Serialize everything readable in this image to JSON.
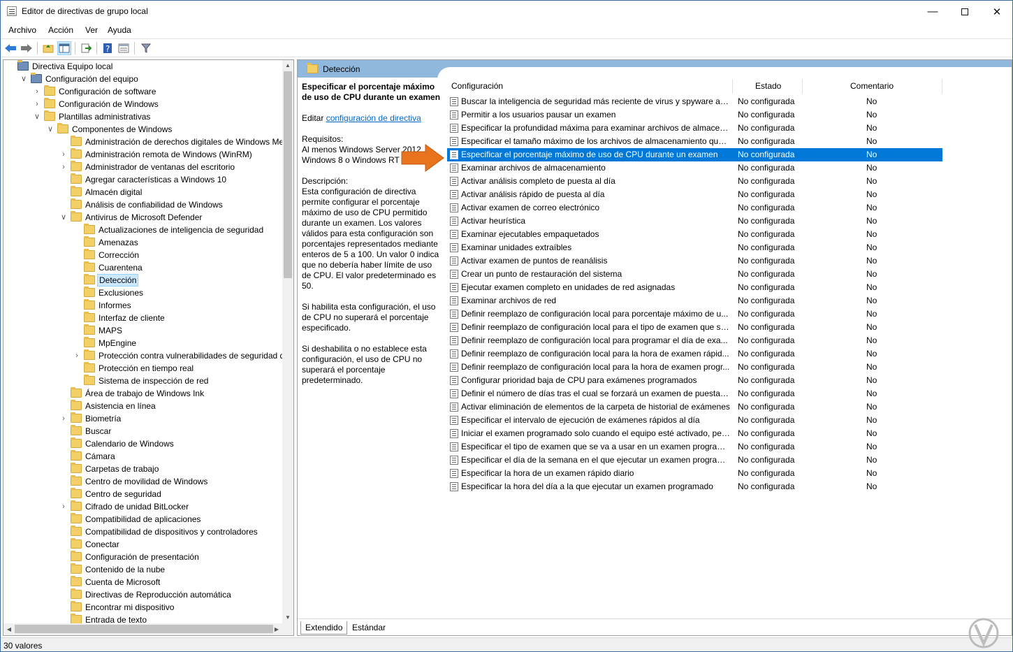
{
  "window": {
    "title": "Editor de directivas de grupo local"
  },
  "menu": [
    "Archivo",
    "Acción",
    "Ver",
    "Ayuda"
  ],
  "tree": [
    {
      "label": "Directiva Equipo local",
      "level": 0,
      "exp": "",
      "icon": "computer"
    },
    {
      "label": "Configuración del equipo",
      "level": 1,
      "exp": "v",
      "icon": "computer"
    },
    {
      "label": "Configuración de software",
      "level": 2,
      "exp": ">",
      "icon": "folder"
    },
    {
      "label": "Configuración de Windows",
      "level": 2,
      "exp": ">",
      "icon": "folder"
    },
    {
      "label": "Plantillas administrativas",
      "level": 2,
      "exp": "v",
      "icon": "folder"
    },
    {
      "label": "Componentes de Windows",
      "level": 3,
      "exp": "v",
      "icon": "folder"
    },
    {
      "label": "Administración de derechos digitales de Windows Media",
      "level": 4,
      "exp": "",
      "icon": "folder"
    },
    {
      "label": "Administración remota de Windows (WinRM)",
      "level": 4,
      "exp": ">",
      "icon": "folder"
    },
    {
      "label": "Administrador de ventanas del escritorio",
      "level": 4,
      "exp": ">",
      "icon": "folder"
    },
    {
      "label": "Agregar características a Windows 10",
      "level": 4,
      "exp": "",
      "icon": "folder"
    },
    {
      "label": "Almacén digital",
      "level": 4,
      "exp": "",
      "icon": "folder"
    },
    {
      "label": "Análisis de confiabilidad de Windows",
      "level": 4,
      "exp": "",
      "icon": "folder"
    },
    {
      "label": "Antivirus de Microsoft Defender",
      "level": 4,
      "exp": "v",
      "icon": "folder"
    },
    {
      "label": "Actualizaciones de inteligencia de seguridad",
      "level": 5,
      "exp": "",
      "icon": "folder"
    },
    {
      "label": "Amenazas",
      "level": 5,
      "exp": "",
      "icon": "folder"
    },
    {
      "label": "Corrección",
      "level": 5,
      "exp": "",
      "icon": "folder"
    },
    {
      "label": "Cuarentena",
      "level": 5,
      "exp": "",
      "icon": "folder"
    },
    {
      "label": "Detección",
      "level": 5,
      "exp": "",
      "icon": "folder",
      "selected": true
    },
    {
      "label": "Exclusiones",
      "level": 5,
      "exp": "",
      "icon": "folder"
    },
    {
      "label": "Informes",
      "level": 5,
      "exp": "",
      "icon": "folder"
    },
    {
      "label": "Interfaz de cliente",
      "level": 5,
      "exp": "",
      "icon": "folder"
    },
    {
      "label": "MAPS",
      "level": 5,
      "exp": "",
      "icon": "folder"
    },
    {
      "label": "MpEngine",
      "level": 5,
      "exp": "",
      "icon": "folder"
    },
    {
      "label": "Protección contra vulnerabilidades de seguridad de M",
      "level": 5,
      "exp": ">",
      "icon": "folder"
    },
    {
      "label": "Protección en tiempo real",
      "level": 5,
      "exp": "",
      "icon": "folder"
    },
    {
      "label": "Sistema de inspección de red",
      "level": 5,
      "exp": "",
      "icon": "folder"
    },
    {
      "label": "Área de trabajo de Windows Ink",
      "level": 4,
      "exp": "",
      "icon": "folder"
    },
    {
      "label": "Asistencia en línea",
      "level": 4,
      "exp": "",
      "icon": "folder"
    },
    {
      "label": "Biometría",
      "level": 4,
      "exp": ">",
      "icon": "folder"
    },
    {
      "label": "Buscar",
      "level": 4,
      "exp": "",
      "icon": "folder"
    },
    {
      "label": "Calendario de Windows",
      "level": 4,
      "exp": "",
      "icon": "folder"
    },
    {
      "label": "Cámara",
      "level": 4,
      "exp": "",
      "icon": "folder"
    },
    {
      "label": "Carpetas de trabajo",
      "level": 4,
      "exp": "",
      "icon": "folder"
    },
    {
      "label": "Centro de movilidad de Windows",
      "level": 4,
      "exp": "",
      "icon": "folder"
    },
    {
      "label": "Centro de seguridad",
      "level": 4,
      "exp": "",
      "icon": "folder"
    },
    {
      "label": "Cifrado de unidad BitLocker",
      "level": 4,
      "exp": ">",
      "icon": "folder"
    },
    {
      "label": "Compatibilidad de aplicaciones",
      "level": 4,
      "exp": "",
      "icon": "folder"
    },
    {
      "label": "Compatibilidad de dispositivos y controladores",
      "level": 4,
      "exp": "",
      "icon": "folder"
    },
    {
      "label": "Conectar",
      "level": 4,
      "exp": "",
      "icon": "folder"
    },
    {
      "label": "Configuración de presentación",
      "level": 4,
      "exp": "",
      "icon": "folder"
    },
    {
      "label": "Contenido de la nube",
      "level": 4,
      "exp": "",
      "icon": "folder"
    },
    {
      "label": "Cuenta de Microsoft",
      "level": 4,
      "exp": "",
      "icon": "folder"
    },
    {
      "label": "Directivas de Reproducción automática",
      "level": 4,
      "exp": "",
      "icon": "folder"
    },
    {
      "label": "Encontrar mi dispositivo",
      "level": 4,
      "exp": "",
      "icon": "folder"
    },
    {
      "label": "Entrada de texto",
      "level": 4,
      "exp": "",
      "icon": "folder"
    }
  ],
  "pane": {
    "header": "Detección"
  },
  "description": {
    "title": "Especificar el porcentaje máximo de uso de CPU durante un examen",
    "edit_prefix": "Editar ",
    "edit_link": "configuración de directiva",
    "req_label": "Requisitos:",
    "req_text": "Al menos Windows Server 2012, Windows 8 o Windows RT",
    "desc_label": "Descripción:",
    "desc_text": "Esta configuración de directiva permite configurar el porcentaje máximo de uso de CPU permitido durante un examen. Los valores válidos para esta configuración son porcentajes representados mediante enteros de 5 a 100. Un valor 0 indica que no debería haber límite de uso de CPU. El valor predeterminado es 50.",
    "p2": "Si habilita esta configuración, el uso de CPU no superará el porcentaje especificado.",
    "p3": "Si deshabilita o no establece esta configuración, el uso de CPU no superará el porcentaje predeterminado."
  },
  "columns": {
    "config": "Configuración",
    "state": "Estado",
    "comment": "Comentario"
  },
  "policies": [
    {
      "name": "Buscar la inteligencia de seguridad más reciente de virus y spyware ant...",
      "state": "No configurada",
      "comment": "No"
    },
    {
      "name": "Permitir a los usuarios pausar un examen",
      "state": "No configurada",
      "comment": "No"
    },
    {
      "name": "Especificar la profundidad máxima para examinar archivos de almacen...",
      "state": "No configurada",
      "comment": "No"
    },
    {
      "name": "Especificar el tamaño máximo de los archivos de almacenamiento que ...",
      "state": "No configurada",
      "comment": "No"
    },
    {
      "name": "Especificar el porcentaje máximo de uso de CPU durante un examen",
      "state": "No configurada",
      "comment": "No",
      "selected": true
    },
    {
      "name": "Examinar archivos de almacenamiento",
      "state": "No configurada",
      "comment": "No"
    },
    {
      "name": "Activar análisis completo de puesta al día",
      "state": "No configurada",
      "comment": "No"
    },
    {
      "name": "Activar análisis rápido de puesta al día",
      "state": "No configurada",
      "comment": "No"
    },
    {
      "name": "Activar examen de correo electrónico",
      "state": "No configurada",
      "comment": "No"
    },
    {
      "name": "Activar heurística",
      "state": "No configurada",
      "comment": "No"
    },
    {
      "name": "Examinar ejecutables empaquetados",
      "state": "No configurada",
      "comment": "No"
    },
    {
      "name": "Examinar unidades extraíbles",
      "state": "No configurada",
      "comment": "No"
    },
    {
      "name": "Activar examen de puntos de reanálisis",
      "state": "No configurada",
      "comment": "No"
    },
    {
      "name": "Crear un punto de restauración del sistema",
      "state": "No configurada",
      "comment": "No"
    },
    {
      "name": "Ejecutar examen completo en unidades de red asignadas",
      "state": "No configurada",
      "comment": "No"
    },
    {
      "name": "Examinar archivos de red",
      "state": "No configurada",
      "comment": "No"
    },
    {
      "name": "Definir reemplazo de configuración local para porcentaje máximo de u...",
      "state": "No configurada",
      "comment": "No"
    },
    {
      "name": "Definir reemplazo de configuración local para el tipo de examen que se...",
      "state": "No configurada",
      "comment": "No"
    },
    {
      "name": "Definir reemplazo de configuración local para programar el día de exa...",
      "state": "No configurada",
      "comment": "No"
    },
    {
      "name": "Definir reemplazo de configuración local para la hora de examen rápid...",
      "state": "No configurada",
      "comment": "No"
    },
    {
      "name": "Definir reemplazo de configuración local para la hora de examen progr...",
      "state": "No configurada",
      "comment": "No"
    },
    {
      "name": "Configurar prioridad baja de CPU para exámenes programados",
      "state": "No configurada",
      "comment": "No"
    },
    {
      "name": "Definir el número de días tras el cual se forzará un examen de puesta al ...",
      "state": "No configurada",
      "comment": "No"
    },
    {
      "name": "Activar eliminación de elementos de la carpeta de historial de exámenes",
      "state": "No configurada",
      "comment": "No"
    },
    {
      "name": "Especificar el intervalo de ejecución de exámenes rápidos al día",
      "state": "No configurada",
      "comment": "No"
    },
    {
      "name": "Iniciar el examen programado solo cuando el equipo esté activado, per...",
      "state": "No configurada",
      "comment": "No"
    },
    {
      "name": "Especificar el tipo de examen que se va a usar en un examen programa...",
      "state": "No configurada",
      "comment": "No"
    },
    {
      "name": "Especificar el día de la semana en el que ejecutar un examen programa...",
      "state": "No configurada",
      "comment": "No"
    },
    {
      "name": "Especificar la hora de un examen rápido diario",
      "state": "No configurada",
      "comment": "No"
    },
    {
      "name": "Especificar la hora del día a la que ejecutar un examen programado",
      "state": "No configurada",
      "comment": "No"
    }
  ],
  "tabs": [
    "Extendido",
    "Estándar"
  ],
  "status": "30 valores",
  "colors": {
    "selection": "#0078d7",
    "header": "#8fb8dc",
    "folder": "#f3cf68",
    "arrow": "#e8731c"
  }
}
